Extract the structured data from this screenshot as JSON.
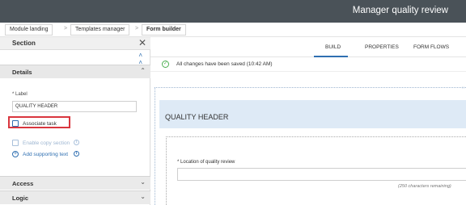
{
  "header": {
    "title": "Manager quality review"
  },
  "breadcrumb": {
    "items": [
      "Module landing",
      "Templates manager",
      "Form builder"
    ],
    "separator": ">"
  },
  "left_panel": {
    "title": "Section",
    "close_icon": "close-icon",
    "collapse_icon": "double-chevron-up-icon",
    "details_label": "Details",
    "label_field_label": "* Label",
    "label_field_value": "QUALITY HEADER",
    "associate_task_label": "Associate task",
    "enable_copy_label": "Enable copy section",
    "add_supporting_text_label": "Add supporting text",
    "access_label": "Access",
    "logic_label": "Logic"
  },
  "tabs": {
    "items": [
      "BUILD",
      "PROPERTIES",
      "FORM FLOWS"
    ],
    "active": "BUILD"
  },
  "status": {
    "text": "All changes have been saved (10:42 AM)"
  },
  "canvas": {
    "section_title": "QUALITY HEADER",
    "field_label": "Location of quality review",
    "field_required_marker": "*",
    "remaining_text": "(250 characters remaining)"
  },
  "colors": {
    "topbar": "#4a5258",
    "accent": "#2f6fb1",
    "highlight_border": "#d9363e",
    "section_band": "#deeaf6",
    "success": "#4caf50"
  }
}
